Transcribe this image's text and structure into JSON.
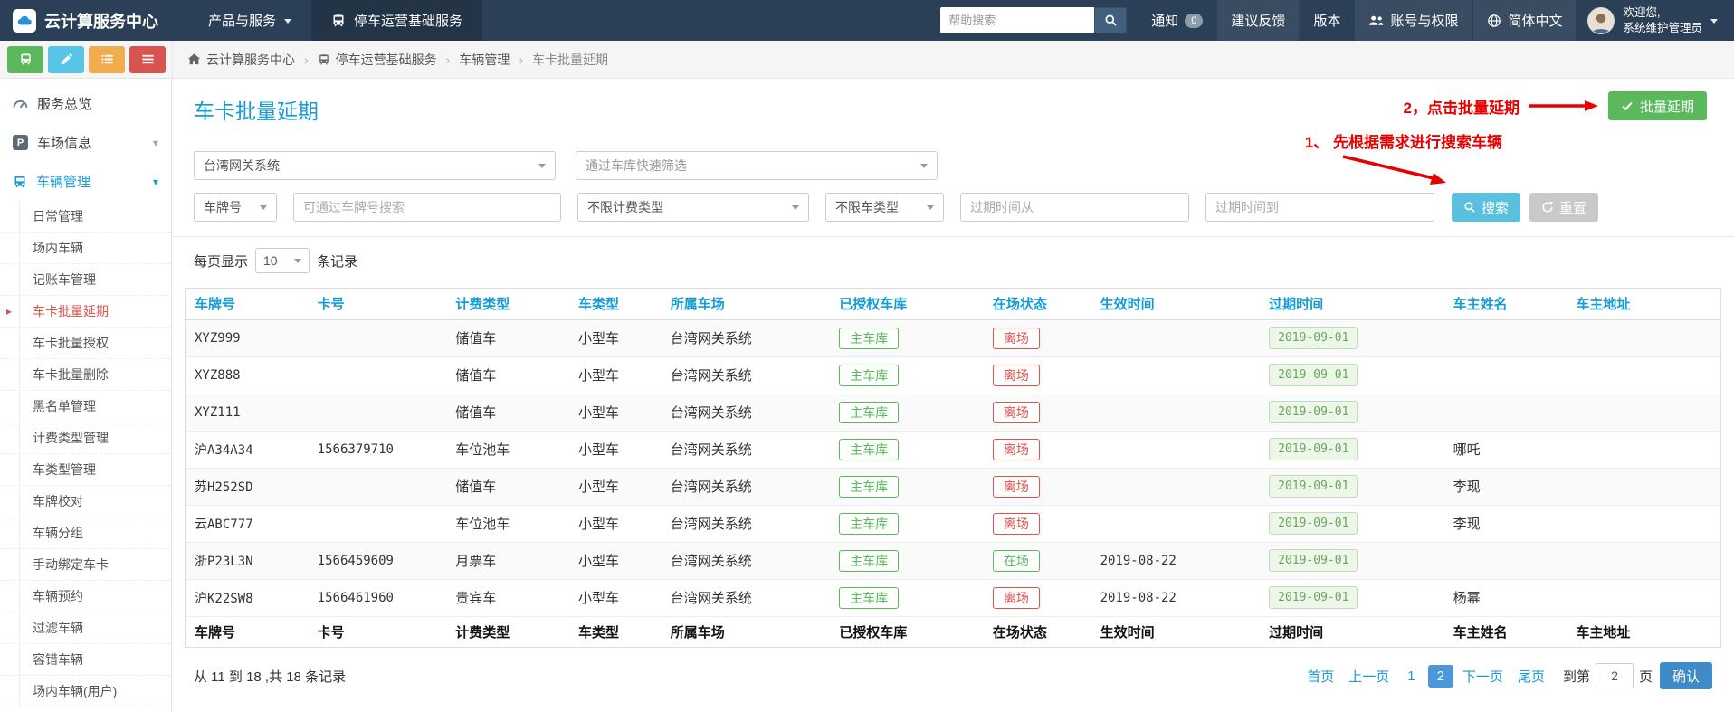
{
  "colors": {
    "topbar_bg": "#2b3f56",
    "accent_blue": "#169bd5",
    "green": "#5cb85c",
    "red": "#d9534f",
    "search_blue": "#5bc0de",
    "annotation_red": "#e60000",
    "pg_active": "#4a98d8",
    "confirm_blue": "#3e8bc7"
  },
  "topbar": {
    "brand": "云计算服务中心",
    "menu": [
      {
        "label": "产品与服务"
      },
      {
        "label": "停车运营基础服务"
      }
    ],
    "search_placeholder": "帮助搜索",
    "notice_label": "通知",
    "notice_badge": "0",
    "feedback_label": "建议反馈",
    "version_label": "版本",
    "account_label": "账号与权限",
    "language_label": "简体中文",
    "welcome_line1": "欢迎您,",
    "welcome_line2": "系统维护管理员"
  },
  "breadcrumb": {
    "items": [
      "云计算服务中心",
      "停车运营基础服务",
      "车辆管理",
      "车卡批量延期"
    ]
  },
  "sidebar": {
    "overview": "服务总览",
    "lot_info": "车场信息",
    "vehicle_menu": {
      "label": "车辆管理",
      "items": [
        {
          "label": "日常管理"
        },
        {
          "label": "场内车辆"
        },
        {
          "label": "记账车管理"
        },
        {
          "label": "车卡批量延期",
          "active": true
        },
        {
          "label": "车卡批量授权"
        },
        {
          "label": "车卡批量删除"
        },
        {
          "label": "黑名单管理"
        },
        {
          "label": "计费类型管理"
        },
        {
          "label": "车类型管理"
        },
        {
          "label": "车牌校对"
        },
        {
          "label": "车辆分组"
        },
        {
          "label": "手动绑定车卡"
        },
        {
          "label": "车辆预约"
        },
        {
          "label": "过滤车辆"
        },
        {
          "label": "容错车辆"
        },
        {
          "label": "场内车辆(用户)"
        }
      ]
    }
  },
  "page": {
    "title": "车卡批量延期",
    "annotation_step2": "2，点击批量延期",
    "annotation_step1": "1、 先根据需求进行搜索车辆",
    "batch_extend_button": "批量延期"
  },
  "filters": {
    "system_select": "台湾网关系统",
    "garage_filter_placeholder": "通过车库快速筛选",
    "field_select": "车牌号",
    "plate_input_placeholder": "可通过车牌号搜索",
    "fee_type_select": "不限计费类型",
    "vehicle_type_select": "不限车类型",
    "expire_from_placeholder": "过期时间从",
    "expire_to_placeholder": "过期时间到",
    "search_button": "搜索",
    "reset_button": "重置"
  },
  "per_page": {
    "prefix": "每页显示",
    "value": "10",
    "suffix": "条记录"
  },
  "table": {
    "columns": [
      "车牌号",
      "卡号",
      "计费类型",
      "车类型",
      "所属车场",
      "已授权车库",
      "在场状态",
      "生效时间",
      "过期时间",
      "车主姓名",
      "车主地址"
    ],
    "rows": [
      {
        "plate": "XYZ999",
        "card": "",
        "fee_type": "储值车",
        "vehicle_type": "小型车",
        "lot": "台湾网关系统",
        "garage": "主车库",
        "status": "离场",
        "status_color": "red",
        "effective": "",
        "expire": "2019-09-01",
        "owner": "",
        "address": ""
      },
      {
        "plate": "XYZ888",
        "card": "",
        "fee_type": "储值车",
        "vehicle_type": "小型车",
        "lot": "台湾网关系统",
        "garage": "主车库",
        "status": "离场",
        "status_color": "red",
        "effective": "",
        "expire": "2019-09-01",
        "owner": "",
        "address": ""
      },
      {
        "plate": "XYZ111",
        "card": "",
        "fee_type": "储值车",
        "vehicle_type": "小型车",
        "lot": "台湾网关系统",
        "garage": "主车库",
        "status": "离场",
        "status_color": "red",
        "effective": "",
        "expire": "2019-09-01",
        "owner": "",
        "address": ""
      },
      {
        "plate": "沪A34A34",
        "card": "1566379710",
        "fee_type": "车位池车",
        "vehicle_type": "小型车",
        "lot": "台湾网关系统",
        "garage": "主车库",
        "status": "离场",
        "status_color": "red",
        "effective": "",
        "expire": "2019-09-01",
        "owner": "哪吒",
        "address": ""
      },
      {
        "plate": "苏H252SD",
        "card": "",
        "fee_type": "储值车",
        "vehicle_type": "小型车",
        "lot": "台湾网关系统",
        "garage": "主车库",
        "status": "离场",
        "status_color": "red",
        "effective": "",
        "expire": "2019-09-01",
        "owner": "李现",
        "address": ""
      },
      {
        "plate": "云ABC777",
        "card": "",
        "fee_type": "车位池车",
        "vehicle_type": "小型车",
        "lot": "台湾网关系统",
        "garage": "主车库",
        "status": "离场",
        "status_color": "red",
        "effective": "",
        "expire": "2019-09-01",
        "owner": "李现",
        "address": ""
      },
      {
        "plate": "浙P23L3N",
        "card": "1566459609",
        "fee_type": "月票车",
        "vehicle_type": "小型车",
        "lot": "台湾网关系统",
        "garage": "主车库",
        "status": "在场",
        "status_color": "green",
        "effective": "2019-08-22",
        "expire": "2019-09-01",
        "owner": "",
        "address": ""
      },
      {
        "plate": "沪K22SW8",
        "card": "1566461960",
        "fee_type": "贵宾车",
        "vehicle_type": "小型车",
        "lot": "台湾网关系统",
        "garage": "主车库",
        "status": "离场",
        "status_color": "red",
        "effective": "2019-08-22",
        "expire": "2019-09-01",
        "owner": "杨幂",
        "address": ""
      }
    ]
  },
  "footer": {
    "summary": "从 11 到 18 ,共 18 条记录",
    "pagination": {
      "links": [
        {
          "label": "首页"
        },
        {
          "label": "上一页"
        },
        {
          "label": "1",
          "page": true
        },
        {
          "label": "2",
          "page": true,
          "active": true
        },
        {
          "label": "下一页"
        },
        {
          "label": "尾页"
        }
      ],
      "goto_prefix": "到第",
      "goto_value": "2",
      "goto_suffix": "页",
      "confirm_button": "确认"
    }
  }
}
